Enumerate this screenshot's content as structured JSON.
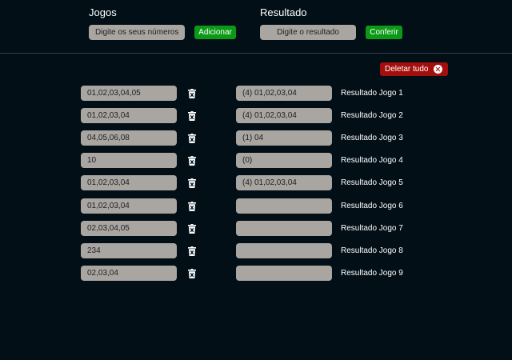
{
  "header": {
    "games_title": "Jogos",
    "results_title": "Resultado",
    "games_input_placeholder": "Digite os seus números",
    "add_button": "Adicionar",
    "results_input_placeholder": "Digite o resultado",
    "check_button": "Conferir"
  },
  "delete_all_label": "Deletar tudo",
  "rows": [
    {
      "game": "01,02,03,04,05",
      "result": "(4) 01,02,03,04",
      "label": "Resultado Jogo 1"
    },
    {
      "game": "01,02,03,04",
      "result": "(4) 01,02,03,04",
      "label": "Resultado Jogo 2"
    },
    {
      "game": "04,05,06,08",
      "result": "(1) 04",
      "label": "Resultado Jogo 3"
    },
    {
      "game": "10",
      "result": "(0)",
      "label": "Resultado Jogo 4"
    },
    {
      "game": "01,02,03,04",
      "result": "(4) 01,02,03,04",
      "label": "Resultado Jogo 5"
    },
    {
      "game": "01,02,03,04",
      "result": "",
      "label": "Resultado Jogo 6"
    },
    {
      "game": "02,03,04,05",
      "result": "",
      "label": "Resultado Jogo 7"
    },
    {
      "game": "234",
      "result": "",
      "label": "Resultado Jogo 8"
    },
    {
      "game": "02,03,04",
      "result": "",
      "label": "Resultado Jogo 9"
    }
  ],
  "colors": {
    "background": "#020f17",
    "input_bg": "#a9a6a2",
    "green": "#0b9a17",
    "red": "#a20f0c"
  },
  "icons": {
    "row_delete": "trash-x-icon",
    "delete_all": "x-circle-icon"
  }
}
